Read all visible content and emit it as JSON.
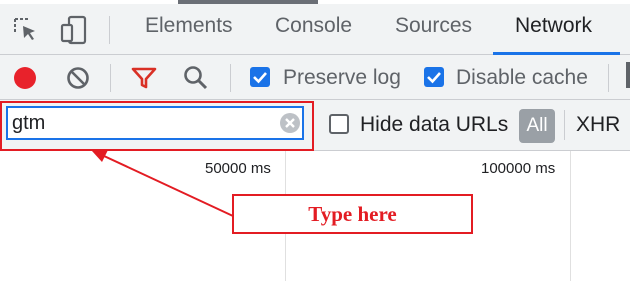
{
  "devtools": {
    "tabs": [
      {
        "label": "Elements"
      },
      {
        "label": "Console"
      },
      {
        "label": "Sources"
      },
      {
        "label": "Network"
      }
    ],
    "active_tab": "Network",
    "toolbar": {
      "preserve_log": {
        "label": "Preserve log",
        "checked": true
      },
      "disable_cache": {
        "label": "Disable cache",
        "checked": true
      }
    },
    "filter": {
      "value": "gtm",
      "hide_data_urls": {
        "label": "Hide data URLs",
        "checked": false
      },
      "type_buttons": [
        {
          "label": "All",
          "selected": true
        },
        {
          "label": "XHR",
          "selected": false
        }
      ]
    },
    "timeline": {
      "ticks": [
        "50000 ms",
        "100000 ms"
      ]
    }
  },
  "annotation": {
    "callout_text": "Type here",
    "color": "#e31c23"
  },
  "colors": {
    "accent": "#1a73e8",
    "record": "#e8222b",
    "filter_icon": "#d93025",
    "annotation": "#e31c23"
  }
}
